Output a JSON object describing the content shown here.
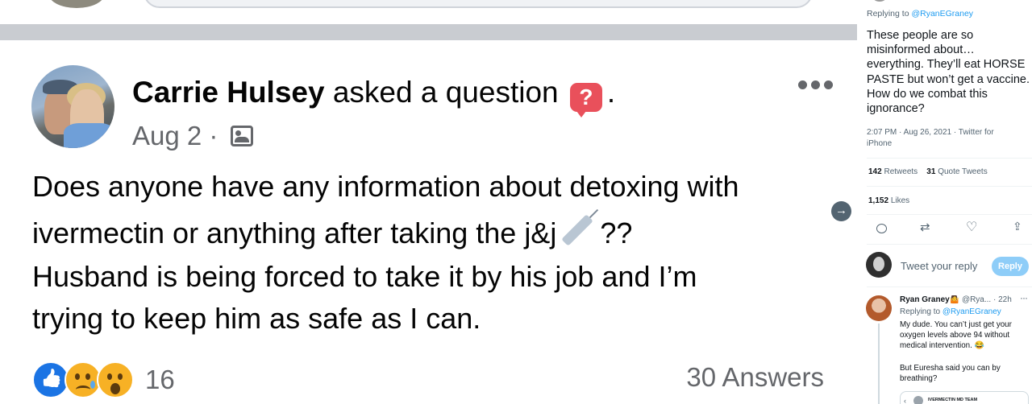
{
  "facebook_post": {
    "author": "Carrie Hulsey",
    "action": "asked a question",
    "question_icon": "?",
    "trailing_period": ".",
    "date": "Aug 2",
    "separator": "·",
    "audience_icon": "photo-audience-icon",
    "post_lines": [
      "Does anyone have any information about detoxing with",
      "ivermectin or anything after taking the j&j",
      "??",
      "Husband is being forced to take it by his job and I’m",
      "trying to keep him as safe as I can."
    ],
    "reaction_count": "16",
    "answers": "30 Answers",
    "colors": {
      "like": "#1b74e4",
      "question_badge": "#e9505b",
      "secondary_text": "#65676b"
    }
  },
  "twitter": {
    "replying_prefix": "Replying to",
    "replying_handle": "@RyanEGraney",
    "tweet_text": "These people are so misinformed about… everything. They’ll eat HORSE PASTE but won’t get a vaccine. How do we combat this ignorance?",
    "timestamp": "2:07 PM · Aug 26, 2021 · Twitter for iPhone",
    "retweets_count": "142",
    "retweets_label": "Retweets",
    "quote_count": "31",
    "quote_label": "Quote Tweets",
    "likes_count": "1,152",
    "likes_label": "Likes",
    "compose_placeholder": "Tweet your reply",
    "reply_button": "Reply",
    "reply": {
      "name": "Ryan Graney🤷",
      "handle_time": "@Rya... · 22h",
      "more": "···",
      "replying_prefix": "Replying to",
      "replying_handle": "@RyanEGraney",
      "text1": "My dude. You can’t just get your oxygen levels above 94 without medical intervention. 😂",
      "text2": "But Euresha said you can by breathing?",
      "card_label": "IVERMECTIN MD TEAM"
    },
    "colors": {
      "link": "#1d9bf0",
      "reply_button": "#8ecdf8"
    }
  }
}
